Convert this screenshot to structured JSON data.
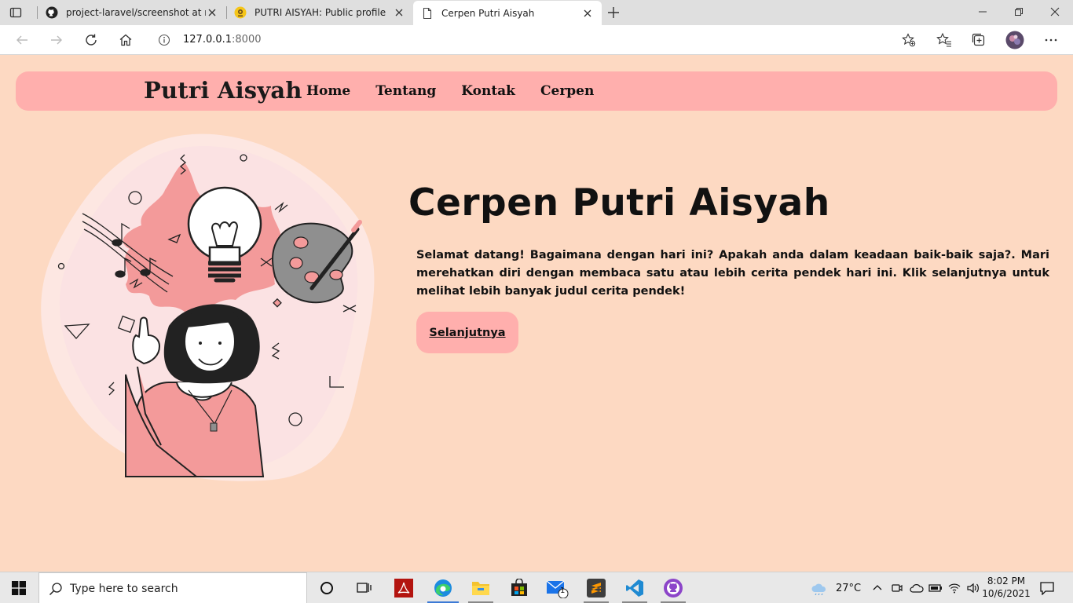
{
  "browser": {
    "tabs": [
      {
        "title": "project-laravel/screenshot at main",
        "icon": "github-icon"
      },
      {
        "title": "PUTRI AISYAH: Public profile",
        "icon": "profile-icon"
      },
      {
        "title": "Cerpen Putri Aisyah",
        "icon": "page-icon",
        "active": true
      }
    ],
    "url_host": "127.0.0.1",
    "url_port": ":8000"
  },
  "site": {
    "brand": "Putri Aisyah",
    "menu": [
      "Home",
      "Tentang",
      "Kontak",
      "Cerpen"
    ],
    "hero_title": "Cerpen Putri Aisyah",
    "hero_text": "Selamat datang! Bagaimana dengan hari ini? Apakah anda dalam keadaan baik-baik saja?. Mari merehatkan diri dengan membaca satu atau lebih cerita pendek hari ini. Klik selanjutnya untuk melihat lebih banyak judul cerita pendek!",
    "cta_label": "Selanjutnya",
    "colors": {
      "background": "#fdd9c2",
      "accent": "#ffafad"
    }
  },
  "taskbar": {
    "search_placeholder": "Type here to search",
    "mail_badge": "1",
    "temperature": "27°C",
    "time": "8:02 PM",
    "date": "10/6/2021"
  }
}
